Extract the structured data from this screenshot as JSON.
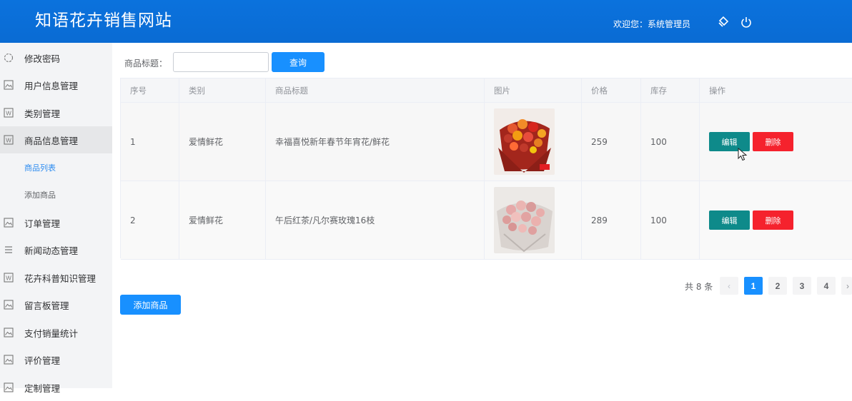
{
  "header": {
    "title": "知语花卉销售网站",
    "welcome": "欢迎您：系统管理员",
    "icons": [
      "theme-icon",
      "power-icon"
    ]
  },
  "sidebar": {
    "items": [
      {
        "label": "修改密码",
        "icon": "password-icon"
      },
      {
        "label": "用户信息管理",
        "icon": "image-icon"
      },
      {
        "label": "类别管理",
        "icon": "word-icon"
      },
      {
        "label": "商品信息管理",
        "icon": "word-icon"
      },
      {
        "label": "订单管理",
        "icon": "image-icon"
      },
      {
        "label": "新闻动态管理",
        "icon": "list-icon"
      },
      {
        "label": "花卉科普知识管理",
        "icon": "word-icon"
      },
      {
        "label": "留言板管理",
        "icon": "image-icon"
      },
      {
        "label": "支付销量统计",
        "icon": "image-icon"
      },
      {
        "label": "评价管理",
        "icon": "image-icon"
      },
      {
        "label": "定制管理",
        "icon": "image-icon"
      }
    ],
    "subitems": [
      {
        "label": "商品列表"
      },
      {
        "label": "添加商品"
      }
    ]
  },
  "search": {
    "label": "商品标题：",
    "value": "",
    "placeholder": "",
    "button": "查询"
  },
  "table": {
    "headers": [
      "序号",
      "类别",
      "商品标题",
      "图片",
      "价格",
      "库存",
      "操作"
    ],
    "rows": [
      {
        "index": "1",
        "category": "爱情鲜花",
        "title": "幸福喜悦新年春节年宵花/鲜花",
        "price": "259",
        "stock": "100"
      },
      {
        "index": "2",
        "category": "爱情鲜花",
        "title": "午后红茶/凡尔赛玫瑰16枝",
        "price": "289",
        "stock": "100"
      }
    ],
    "edit_label": "编辑",
    "delete_label": "删除"
  },
  "pagination": {
    "total": "共 8 条",
    "prev": "‹",
    "next": "›",
    "pages": [
      "1",
      "2",
      "3",
      "4"
    ],
    "current": "1"
  },
  "add_button": "添加商品",
  "colors": {
    "header": "#0a6fd8",
    "primary": "#1890ff",
    "edit": "#0e8a8a",
    "delete": "#f5222d"
  }
}
